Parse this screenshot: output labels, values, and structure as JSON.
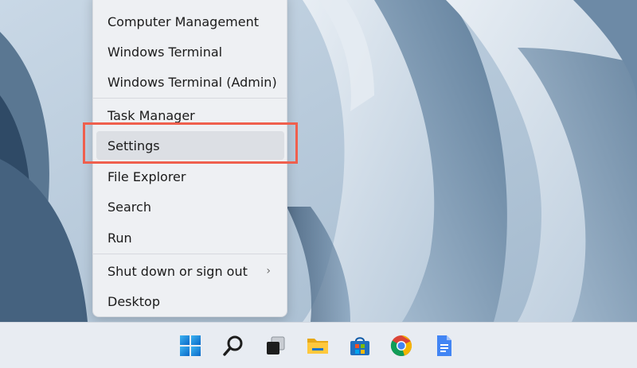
{
  "context_menu": {
    "items": [
      {
        "label": "Computer Management"
      },
      {
        "label": "Windows Terminal"
      },
      {
        "label": "Windows Terminal (Admin)"
      },
      {
        "label": "Task Manager"
      },
      {
        "label": "Settings"
      },
      {
        "label": "File Explorer"
      },
      {
        "label": "Search"
      },
      {
        "label": "Run"
      },
      {
        "label": "Shut down or sign out"
      },
      {
        "label": "Desktop"
      }
    ],
    "selected_item": "Settings",
    "submenu_chevron": "›"
  },
  "taskbar": {
    "icons": [
      "windows-start-icon",
      "search-icon",
      "task-view-icon",
      "file-explorer-icon",
      "microsoft-store-icon",
      "chrome-icon",
      "google-docs-icon"
    ]
  },
  "colors": {
    "highlight": "#ef5f4d",
    "menu_bg": "#eef0f3",
    "taskbar_bg": "#e8ecf2"
  }
}
